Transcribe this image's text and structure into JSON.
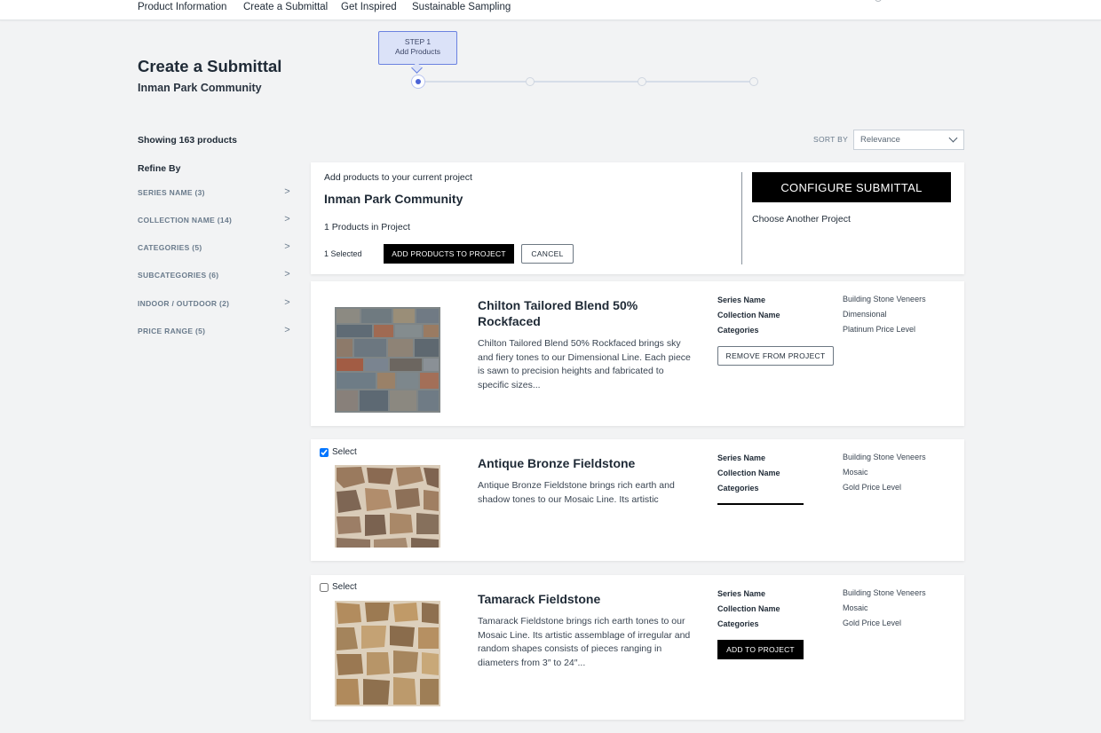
{
  "nav": {
    "items": [
      "Product Information",
      "Create a Submittal",
      "Get Inspired",
      "Sustainable Sampling"
    ]
  },
  "header": {
    "title": "Create a Submittal",
    "subtitle": "Inman Park Community"
  },
  "stepper": {
    "step_label": "STEP 1",
    "step_name": "Add Products",
    "steps_total": 4,
    "current_step": 1
  },
  "filters": {
    "showing": "Showing 163 products",
    "refine_by": "Refine By",
    "items": [
      {
        "label": "SERIES NAME (3)"
      },
      {
        "label": "COLLECTION NAME (14)"
      },
      {
        "label": "CATEGORIES (5)"
      },
      {
        "label": "SUBCATEGORIES (6)"
      },
      {
        "label": "INDOOR / OUTDOOR (2)"
      },
      {
        "label": "PRICE RANGE (5)"
      }
    ],
    "chevron": ">"
  },
  "sort": {
    "label": "SORT BY",
    "value": "Relevance"
  },
  "project": {
    "intro": "Add products to your current project",
    "name": "Inman Park Community",
    "count": "1 Products in Project",
    "selected": "1 Selected",
    "add_button": "ADD PRODUCTS TO PROJECT",
    "cancel_button": "CANCEL",
    "configure_button": "CONFIGURE SUBMITTAL",
    "choose_another": "Choose Another Project"
  },
  "products": [
    {
      "title": "Chilton Tailored Blend 50% Rockfaced",
      "description": "Chilton Tailored Blend 50% Rockfaced brings sky and fiery tones to our Dimensional Line.  Each piece is sawn to precision heights and fabricated to specific sizes...",
      "spec_keys": [
        "Series Name",
        "Collection Name",
        "Categories"
      ],
      "spec_values": [
        "Building Stone Veneers",
        "Dimensional",
        "Platinum Price Level"
      ],
      "action": "REMOVE FROM PROJECT",
      "select_label": "",
      "checked": false
    },
    {
      "title": "Antique Bronze Fieldstone",
      "description": "Antique Bronze Fieldstone brings rich earth and shadow tones to our Mosaic Line. Its artistic",
      "spec_keys": [
        "Series Name",
        "Collection Name",
        "Categories"
      ],
      "spec_values": [
        "Building Stone Veneers",
        "Mosaic",
        "Gold Price Level"
      ],
      "action": "",
      "select_label": "Select",
      "checked": true
    },
    {
      "title": "Tamarack Fieldstone",
      "description": "Tamarack Fieldstone brings rich earth tones to our Mosaic Line. Its artistic assemblage of irregular and random shapes consists of pieces ranging in diameters from 3″ to 24″...",
      "spec_keys": [
        "Series Name",
        "Collection Name",
        "Categories"
      ],
      "spec_values": [
        "Building Stone Veneers",
        "Mosaic",
        "Gold Price Level"
      ],
      "action": "ADD TO PROJECT",
      "select_label": "Select",
      "checked": false
    }
  ]
}
